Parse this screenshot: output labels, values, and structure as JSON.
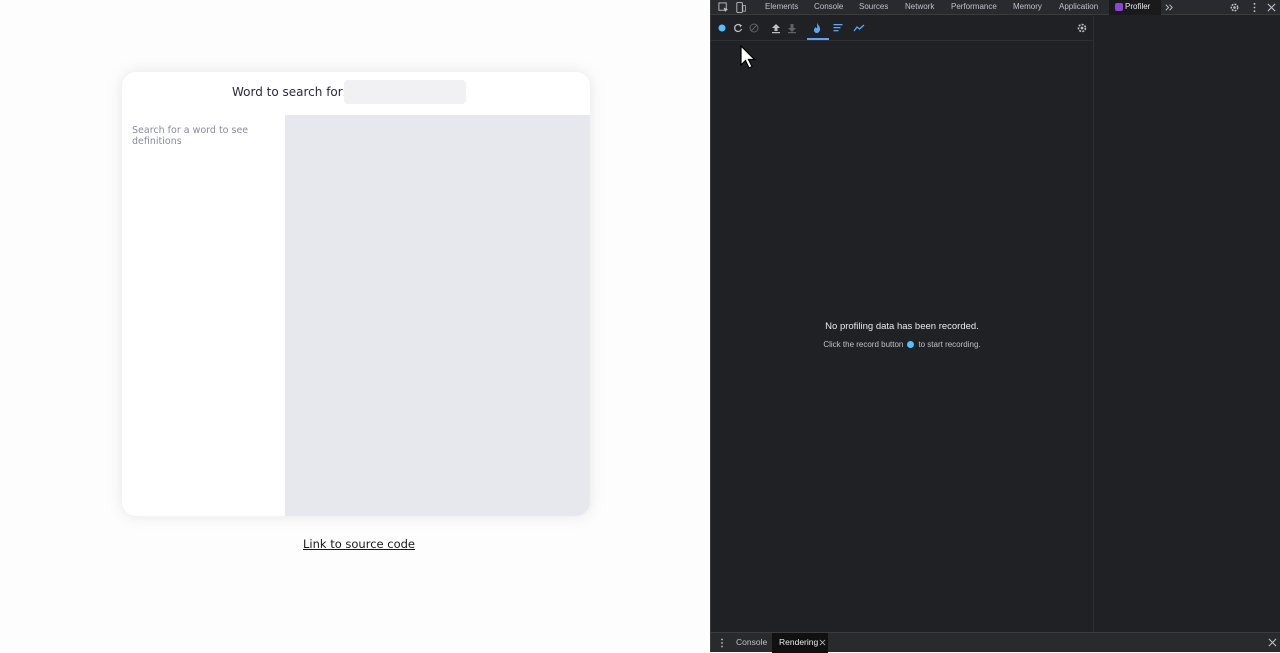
{
  "page": {
    "search_label": "Word to search for:",
    "search_placeholder": "",
    "sidebar_hint": "Search for a word to see definitions",
    "source_link": "Link to source code"
  },
  "devtools": {
    "tabs": [
      "Elements",
      "Console",
      "Sources",
      "Network",
      "Performance",
      "Memory",
      "Application",
      "Profiler"
    ],
    "active_tab": "Profiler",
    "empty_title": "No profiling data has been recorded.",
    "empty_hint_before": "Click the record button",
    "empty_hint_after": "to start recording.",
    "drawer_tabs": [
      "Console",
      "Rendering"
    ],
    "drawer_active": "Rendering",
    "record_color": "#4dc3ff",
    "accent_color": "#58a6ff"
  }
}
